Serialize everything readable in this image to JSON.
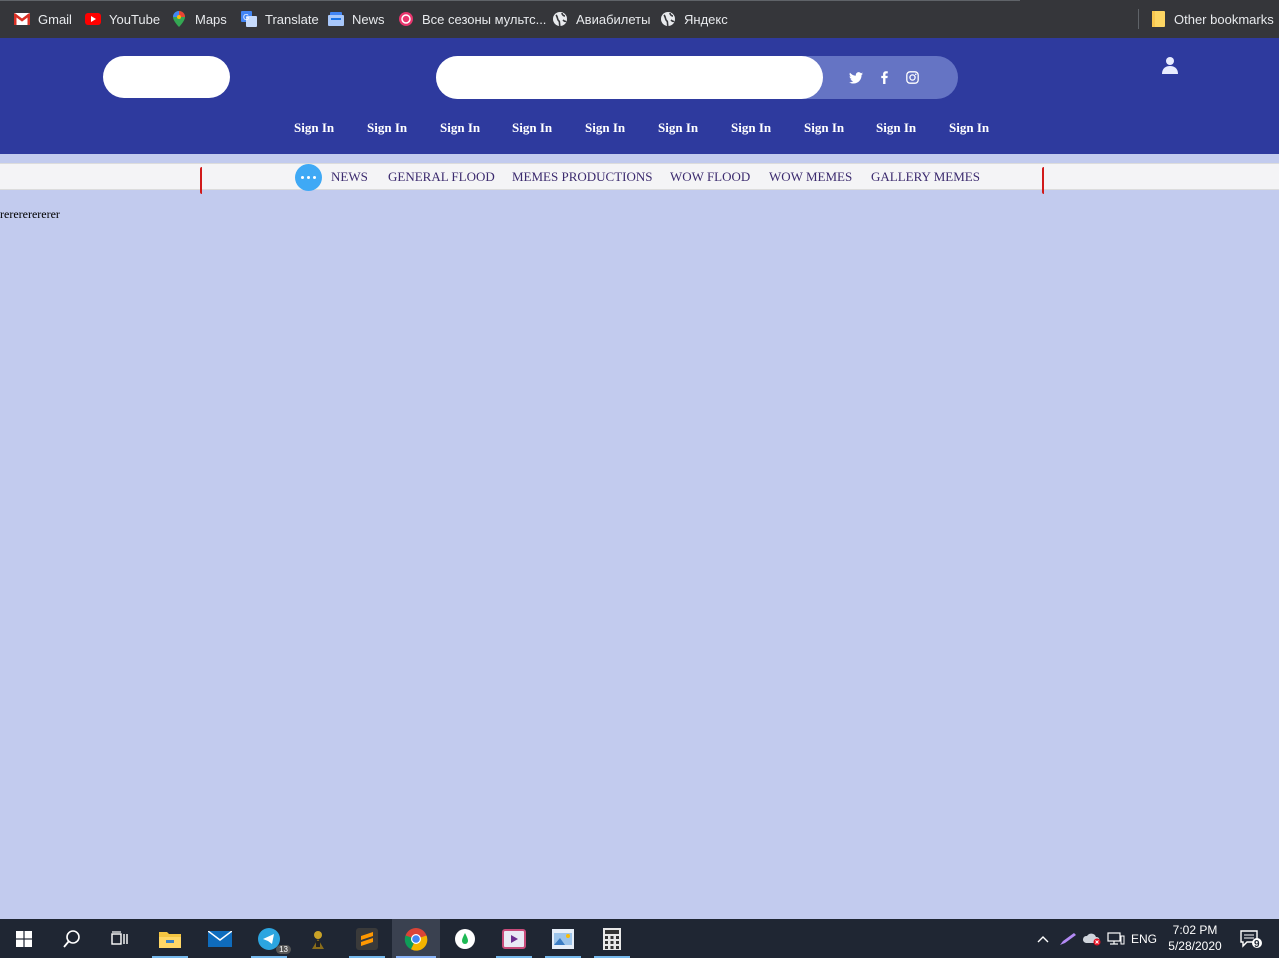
{
  "bookmarks": {
    "items": [
      {
        "label": "Gmail",
        "icon": "gmail-icon"
      },
      {
        "label": "YouTube",
        "icon": "youtube-icon"
      },
      {
        "label": "Maps",
        "icon": "maps-icon"
      },
      {
        "label": "Translate",
        "icon": "translate-icon"
      },
      {
        "label": "News",
        "icon": "news-icon"
      },
      {
        "label": "Все сезоны мультс...",
        "icon": "cartoon-site-icon"
      },
      {
        "label": "Авиабилеты",
        "icon": "globe-icon"
      },
      {
        "label": "Яндекс",
        "icon": "globe-icon"
      }
    ],
    "other": "Other bookmarks"
  },
  "header": {
    "search_placeholder": "",
    "social": [
      "twitter-icon",
      "facebook-icon",
      "instagram-icon"
    ],
    "nav": [
      "Sign In",
      "Sign In",
      "Sign In",
      "Sign In",
      "Sign In",
      "Sign In",
      "Sign In",
      "Sign In",
      "Sign In",
      "Sign In"
    ]
  },
  "categories": [
    "NEWS",
    "GENERAL FLOOD",
    "MEMES PRODUCTIONS",
    "WOW FLOOD",
    "WOW MEMES",
    "GALLERY MEMES"
  ],
  "content": {
    "text": "rerererererer"
  },
  "taskbar": {
    "apps": [
      "start-icon",
      "search-icon",
      "task-view-icon",
      "file-explorer-icon",
      "mail-icon",
      "telegram-icon",
      "game-icon",
      "sublime-text-icon",
      "chrome-icon",
      "app-icon",
      "video-editor-icon",
      "paint-icon",
      "calculator-icon"
    ],
    "telegram_badge": "13",
    "language": "ENG",
    "time": "7:02 PM",
    "date": "5/28/2020",
    "notifications": "9"
  },
  "colors": {
    "page_bg": "#c2cbee",
    "header_bg": "#2e3a9e",
    "category_text": "#3b2a6e",
    "accent_blue": "#3fa9f5",
    "bracket_red": "#d11a1a"
  }
}
